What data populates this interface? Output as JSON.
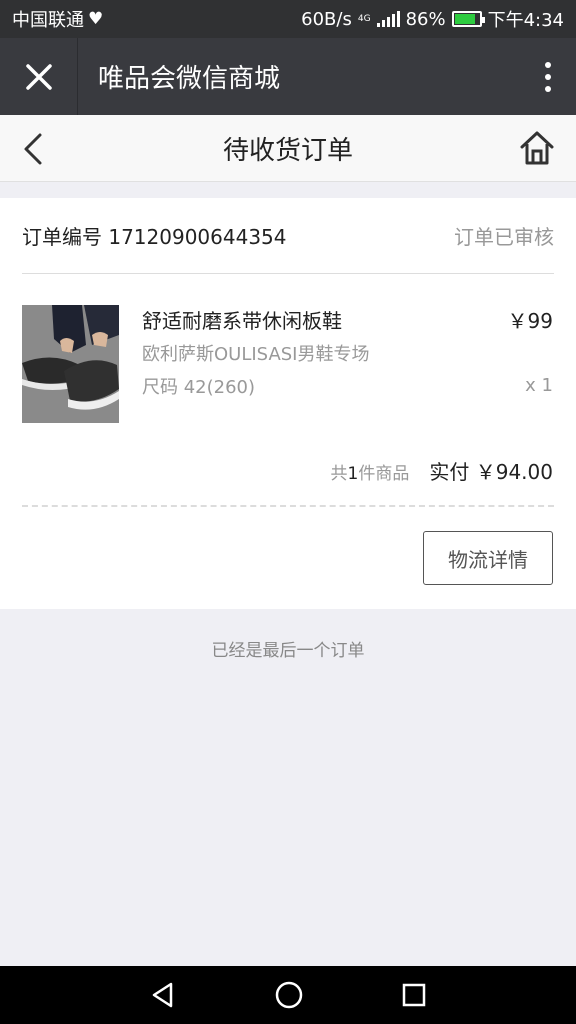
{
  "status_bar": {
    "carrier": "中国联通",
    "net_speed": "60B/s",
    "network_type": "4G",
    "battery": "86%",
    "time": "下午4:34"
  },
  "wechat_bar": {
    "title": "唯品会微信商城"
  },
  "nav": {
    "title": "待收货订单"
  },
  "order": {
    "number_label": "订单编号 17120900644354",
    "status": "订单已审核",
    "product": {
      "name": "舒适耐磨系带休闲板鞋",
      "shop": "欧利萨斯OULISASI男鞋专场",
      "size": "尺码 42(260)",
      "price": "￥99",
      "quantity": "x 1"
    },
    "summary": {
      "count_prefix": "共",
      "count": "1",
      "count_suffix": "件商品",
      "paid": "实付 ￥94.00"
    },
    "logistics_button": "物流详情"
  },
  "end_note": "已经是最后一个订单",
  "colors": {
    "status_bar_bg": "#303133",
    "wechat_bar_bg": "#393a3f",
    "page_bg": "#efeff4",
    "battery_green": "#2ecc40"
  }
}
